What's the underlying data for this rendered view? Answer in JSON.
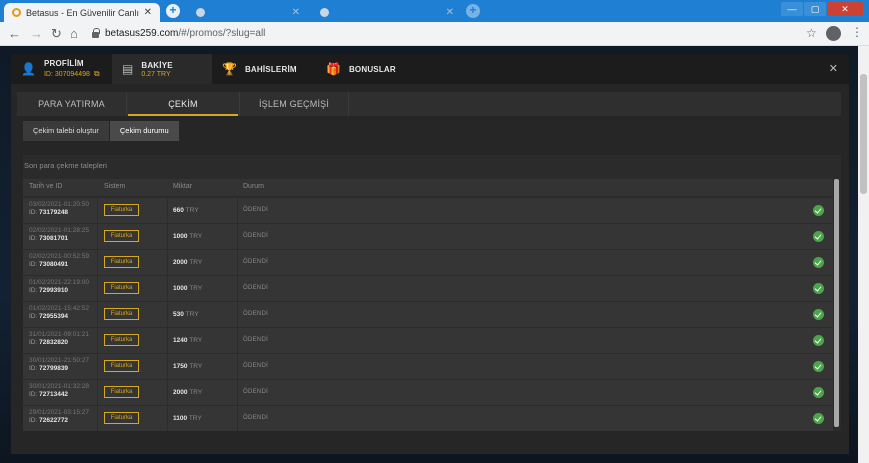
{
  "browser": {
    "tabs": [
      {
        "title": "Betasus - En Güvenilir Canlı Bahis",
        "active": true
      },
      {
        "title": "",
        "active": false
      },
      {
        "title": "",
        "active": false
      }
    ],
    "url_host": "betasus259.com",
    "url_path": "/#/promos/?slug=all"
  },
  "modal": {
    "profile": {
      "label": "PROFİLİM",
      "id": "ID: 307094498"
    },
    "balance": {
      "label": "BAKİYE",
      "value": "0.27 TRY"
    },
    "bets": {
      "label": "BAHİSLERİM"
    },
    "bonuses": {
      "label": "BONUSLAR"
    },
    "subtabs": [
      "PARA YATIRMA",
      "ÇEKİM",
      "İŞLEM GEÇMİŞİ"
    ],
    "actions": [
      "Çekim talebi oluştur",
      "Çekim durumu"
    ],
    "panel_title": "Son para çekme talepleri",
    "columns": {
      "date": "Tarih ve ID",
      "system": "Sistem",
      "amount": "Miktar",
      "status": "Durum"
    },
    "rows": [
      {
        "date": "03/02/2021-01:20:50",
        "id": "73179248",
        "system": "Fiaturka",
        "amount": "660",
        "currency": "TRY",
        "status": "ÖDENDİ"
      },
      {
        "date": "02/02/2021-01:28:25",
        "id": "73081701",
        "system": "Fiaturka",
        "amount": "1000",
        "currency": "TRY",
        "status": "ÖDENDİ"
      },
      {
        "date": "02/02/2021-00:52:59",
        "id": "73080491",
        "system": "Fiaturka",
        "amount": "2000",
        "currency": "TRY",
        "status": "ÖDENDİ"
      },
      {
        "date": "01/02/2021-22:19:00",
        "id": "72993910",
        "system": "Fiaturka",
        "amount": "1000",
        "currency": "TRY",
        "status": "ÖDENDİ"
      },
      {
        "date": "01/02/2021-15:42:52",
        "id": "72955394",
        "system": "Fiaturka",
        "amount": "530",
        "currency": "TRY",
        "status": "ÖDENDİ"
      },
      {
        "date": "31/01/2021-09:01:21",
        "id": "72832820",
        "system": "Fiaturka",
        "amount": "1240",
        "currency": "TRY",
        "status": "ÖDENDİ"
      },
      {
        "date": "30/01/2021-21:50:27",
        "id": "72799839",
        "system": "Fiaturka",
        "amount": "1750",
        "currency": "TRY",
        "status": "ÖDENDİ"
      },
      {
        "date": "30/01/2021-01:32:28",
        "id": "72713442",
        "system": "Fiaturka",
        "amount": "2000",
        "currency": "TRY",
        "status": "ÖDENDİ"
      },
      {
        "date": "29/01/2021-03:15:27",
        "id": "72622772",
        "system": "Fiaturka",
        "amount": "1100",
        "currency": "TRY",
        "status": "ÖDENDİ"
      }
    ]
  },
  "colors": {
    "accent": "#d6a81f",
    "success": "#4aa54b",
    "browser_blue": "#1f7fd2"
  }
}
